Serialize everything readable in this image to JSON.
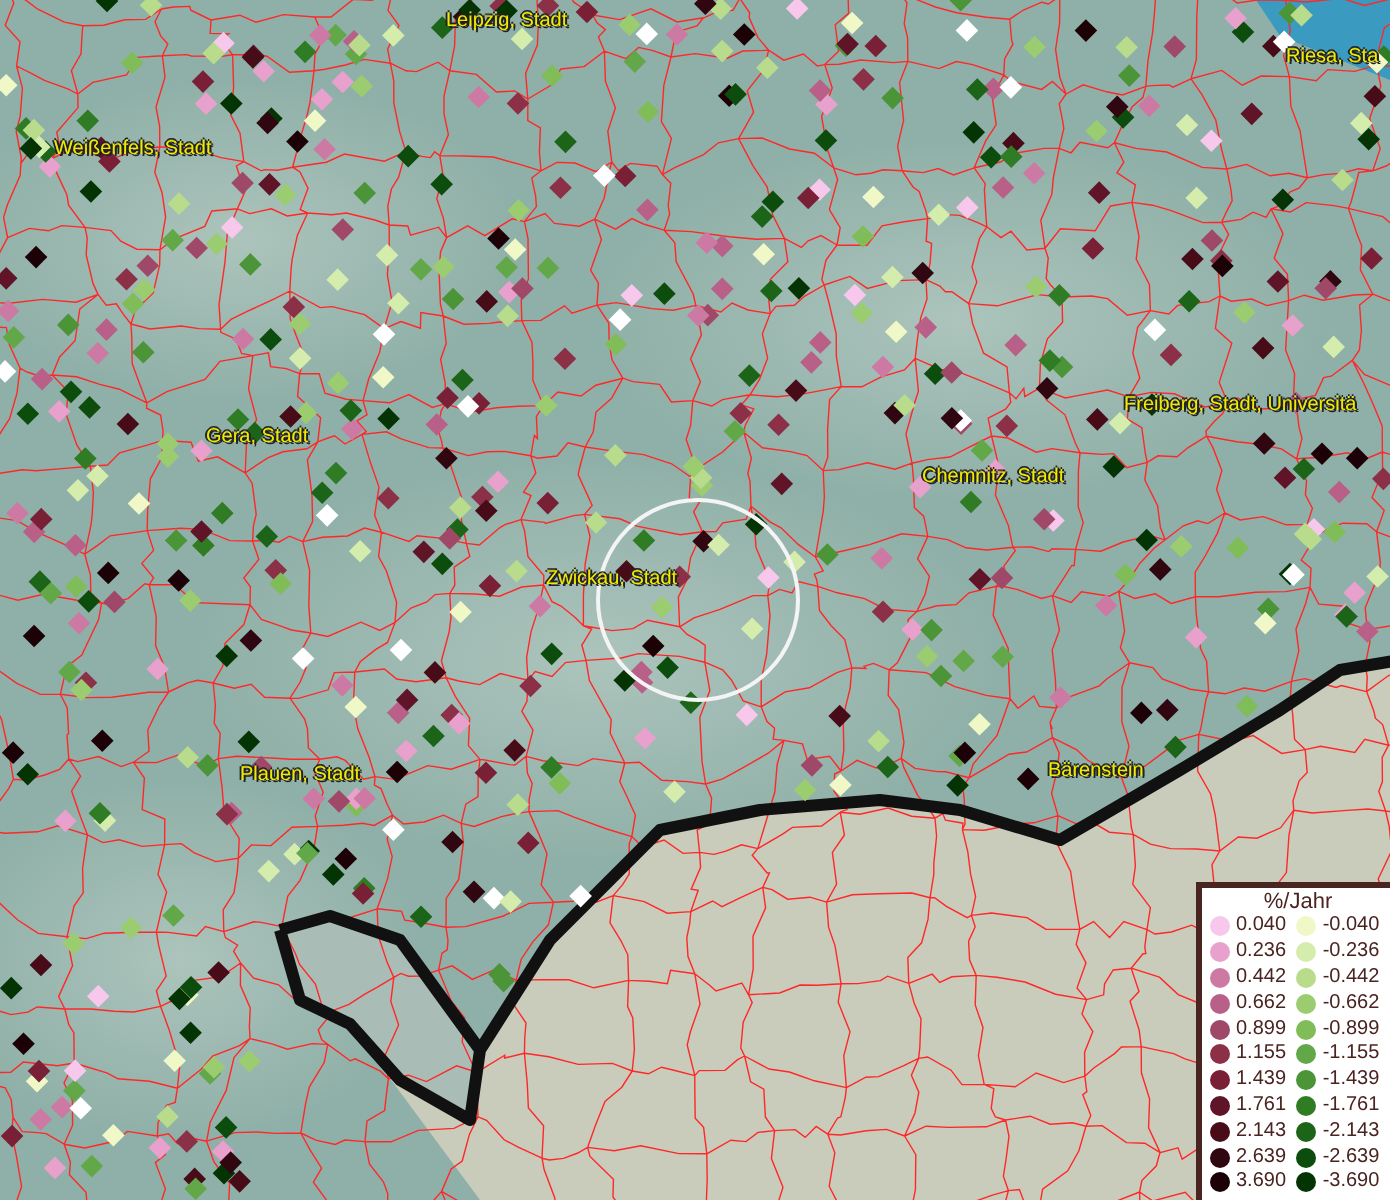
{
  "map": {
    "places": [
      {
        "name": "Leipzig, Stadt"
      },
      {
        "name": "Weißenfels, Stadt"
      },
      {
        "name": "Riesa, Sta"
      },
      {
        "name": "Freiberg, Stadt, Universitä"
      },
      {
        "name": "Gera, Stadt"
      },
      {
        "name": "Chemnitz, Stadt"
      },
      {
        "name": "Zwickau, Stadt"
      },
      {
        "name": "Plauen, Stadt"
      },
      {
        "name": "Bärenstein"
      }
    ]
  },
  "legend": {
    "title": "%/Jahr",
    "rows": [
      {
        "positive": {
          "label": "0.040",
          "color": "#f8c8ec"
        },
        "negative": {
          "label": "-0.040",
          "color": "#f0f8c8"
        }
      },
      {
        "positive": {
          "label": "0.236",
          "color": "#e8a0cc"
        },
        "negative": {
          "label": "-0.236",
          "color": "#d4ecac"
        }
      },
      {
        "positive": {
          "label": "0.442",
          "color": "#cc7aa4"
        },
        "negative": {
          "label": "-0.442",
          "color": "#b8dc8c"
        }
      },
      {
        "positive": {
          "label": "0.662",
          "color": "#b86088"
        },
        "negative": {
          "label": "-0.662",
          "color": "#9ccc70"
        }
      },
      {
        "positive": {
          "label": "0.899",
          "color": "#a04868"
        },
        "negative": {
          "label": "-0.899",
          "color": "#80bc58"
        }
      },
      {
        "positive": {
          "label": "1.155",
          "color": "#8c3048"
        },
        "negative": {
          "label": "-1.155",
          "color": "#62a848"
        }
      },
      {
        "positive": {
          "label": "1.439",
          "color": "#7a2036"
        },
        "negative": {
          "label": "-1.439",
          "color": "#4c9438"
        }
      },
      {
        "positive": {
          "label": "1.761",
          "color": "#601428"
        },
        "negative": {
          "label": "-1.761",
          "color": "#307c24"
        }
      },
      {
        "positive": {
          "label": "2.143",
          "color": "#480c18"
        },
        "negative": {
          "label": "-2.143",
          "color": "#1c6418"
        }
      },
      {
        "positive": {
          "label": "2.639",
          "color": "#300610"
        },
        "negative": {
          "label": "-2.639",
          "color": "#0c4c0c"
        }
      },
      {
        "positive": {
          "label": "3.690",
          "color": "#1c0206"
        },
        "negative": {
          "label": "-3.690",
          "color": "#043404"
        }
      }
    ]
  }
}
